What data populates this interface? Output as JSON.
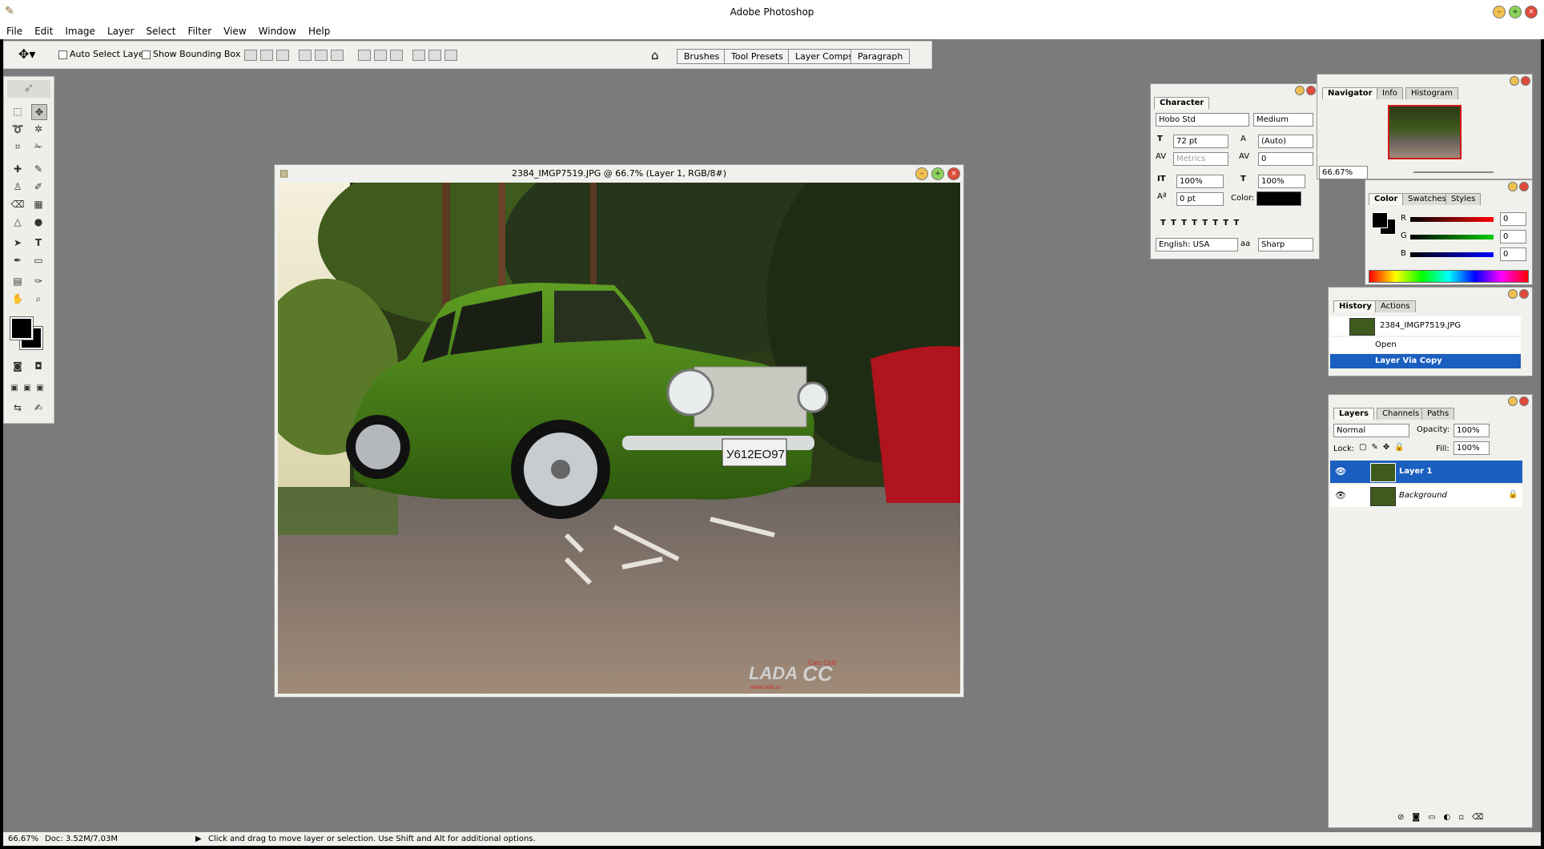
{
  "app": {
    "title": "Adobe Photoshop"
  },
  "menu": [
    "File",
    "Edit",
    "Image",
    "Layer",
    "Select",
    "Filter",
    "View",
    "Window",
    "Help"
  ],
  "options": {
    "auto_select_layer": "Auto Select Layer",
    "show_bounding_box": "Show Bounding Box",
    "well_tabs": [
      "Brushes",
      "Tool Presets",
      "Layer Comps",
      "Paragraph"
    ]
  },
  "document": {
    "title": "2384_IMGP7519.JPG @ 66.7% (Layer 1, RGB/8#)",
    "plate": "У612ЕО97",
    "watermark": "LADA",
    "watermark_cc": "CC",
    "watermark_club": "Cars Club",
    "watermark_url": "www.lada.cc"
  },
  "character": {
    "tab": "Character",
    "font_family": "Hobo Std",
    "font_style": "Medium",
    "size": "72 pt",
    "leading": "(Auto)",
    "kerning": "Metrics",
    "tracking": "0",
    "vscale": "100%",
    "hscale": "100%",
    "baseline": "0 pt",
    "color_label": "Color:",
    "language": "English: USA",
    "aa_label": "aa",
    "antialias": "Sharp"
  },
  "navigator": {
    "tabs": [
      "Navigator",
      "Info",
      "Histogram"
    ],
    "zoom": "66.67%"
  },
  "color": {
    "tabs": [
      "Color",
      "Swatches",
      "Styles"
    ],
    "r_label": "R",
    "g_label": "G",
    "b_label": "B",
    "r": "0",
    "g": "0",
    "b": "0"
  },
  "history": {
    "tabs": [
      "History",
      "Actions"
    ],
    "snapshot": "2384_IMGP7519.JPG",
    "steps": [
      "Open",
      "Layer Via Copy"
    ]
  },
  "layers": {
    "tabs": [
      "Layers",
      "Channels",
      "Paths"
    ],
    "blend": "Normal",
    "opacity_label": "Opacity:",
    "opacity": "100%",
    "lock_label": "Lock:",
    "fill_label": "Fill:",
    "fill": "100%",
    "items": [
      "Layer 1",
      "Background"
    ]
  },
  "status": {
    "zoom": "66.67%",
    "doc": "Doc: 3.52M/7.03M",
    "hint": "Click and drag to move layer or selection.  Use Shift and Alt for additional options."
  }
}
